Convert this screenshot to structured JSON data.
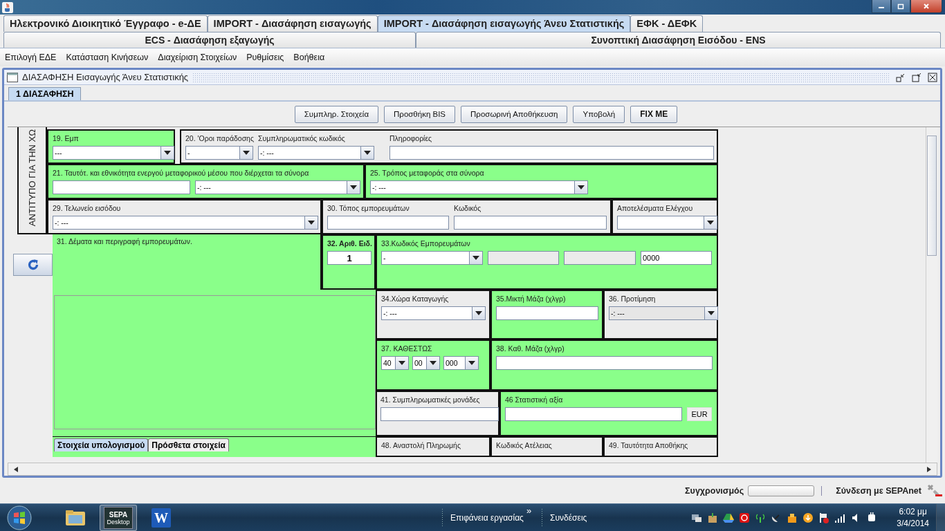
{
  "main_tabs": [
    [
      {
        "label": "Ηλεκτρονικό Διοικητικό Έγγραφο - e-ΔΕ",
        "selected": false
      },
      {
        "label": "IMPORT - Διασάφηση εισαγωγής",
        "selected": false
      },
      {
        "label": "IMPORT - Διασάφηση εισαγωγής Άνευ Στατιστικής",
        "selected": true
      },
      {
        "label": "ΕΦΚ - ΔΕΦΚ",
        "selected": false
      }
    ],
    [
      {
        "label": "ECS - Διασάφηση εξαγωγής",
        "selected": false
      },
      {
        "label": "Συνοπτική Διασάφηση Εισόδου - ENS",
        "selected": false
      }
    ]
  ],
  "menu": [
    "Επιλογή ΕΔΕ",
    "Κατάσταση Κινήσεων",
    "Διαχείριση Στοιχείων",
    "Ρυθμίσεις",
    "Βοήθεια"
  ],
  "frame": {
    "title": "ΔΙΑΣΑΦΗΣΗ Εισαγωγής Άνευ Στατιστικής",
    "tabs": [
      {
        "label": "1 ΔΙΑΣΑΦΗΣΗ",
        "selected": true
      }
    ],
    "buttons": [
      {
        "label": "Συμπληρ. Στοιχεία",
        "kind": "normal"
      },
      {
        "label": "Προσθήκη BIS",
        "kind": "normal"
      },
      {
        "label": "Προσωρινή Αποθήκευση",
        "kind": "normal"
      },
      {
        "label": "Υποβολή",
        "kind": "normal"
      },
      {
        "label": "FIX ME",
        "kind": "strong"
      }
    ]
  },
  "form": {
    "side_label": "ΑΝΤΙΤΥΠΟ ΓΙΑ ΤΗΝ ΧΩ",
    "boxes": [
      {
        "label": "19. Εμπ",
        "highlighted": true,
        "controls": [
          {
            "kind": "combo",
            "value": "---",
            "disabled": false
          }
        ]
      },
      {
        "highlighted": false,
        "controls": [
          {
            "kind": "combo",
            "label": "20. 'Οροι παράδοσης",
            "value": "-",
            "disabled": false
          },
          {
            "kind": "combo",
            "label": "Συμπληρωματικός κωδικός",
            "value": "-: ---",
            "disabled": false
          },
          {
            "kind": "input",
            "label": "Πληροφορίες",
            "disabled": false
          }
        ]
      },
      {
        "label": "21. Ταυτότ. και εθνικότητα ενεργού μεταφορικού μέσου που διέρχεται τα σύνορα",
        "highlighted": true,
        "controls": [
          {
            "kind": "input",
            "disabled": false
          },
          {
            "kind": "combo",
            "value": "-: ---",
            "disabled": false
          }
        ]
      },
      {
        "label": "25. Τρόπος μεταφοράς στα σύνορα",
        "highlighted": true,
        "controls": [
          {
            "kind": "combo",
            "value": "-: ---",
            "disabled": false
          }
        ]
      },
      {
        "label": "29. Τελωνείο εισόδου",
        "highlighted": false,
        "controls": [
          {
            "kind": "combo",
            "value": "-: ---",
            "disabled": false
          }
        ]
      },
      {
        "highlighted": false,
        "controls": [
          {
            "kind": "input",
            "label": "30. Τόπος εμπορευμάτων",
            "disabled": false
          },
          {
            "kind": "input",
            "label": "Κωδικός",
            "disabled": false
          }
        ]
      },
      {
        "label": "Αποτελέσματα Ελέγχου",
        "highlighted": false,
        "controls": [
          {
            "kind": "combo",
            "disabled": false
          }
        ]
      },
      {
        "label": "31. Δέματα και περιγραφή εμπορευμάτων.",
        "highlighted": true
      },
      {
        "label": "32. Αριθ. Ειδ.",
        "label_bold": true,
        "highlighted": true,
        "controls": [
          {
            "kind": "number",
            "value": "1",
            "disabled": false
          }
        ]
      },
      {
        "label": "33.Κωδικός Εμπορευμάτων",
        "highlighted": true,
        "controls": [
          {
            "kind": "combo",
            "value": "-",
            "disabled": false
          },
          {
            "kind": "input",
            "disabled": true
          },
          {
            "kind": "input",
            "disabled": true
          },
          {
            "kind": "input",
            "value": "0000",
            "disabled": false
          }
        ]
      },
      {
        "label": "34.Χώρα Καταγωγής",
        "highlighted": false,
        "controls": [
          {
            "kind": "combo",
            "value": "-: ---",
            "disabled": false
          }
        ]
      },
      {
        "label": "35.Μικτή Μάζα (χλγρ)",
        "highlighted": true,
        "controls": [
          {
            "kind": "input",
            "disabled": false
          }
        ]
      },
      {
        "label": "36. Προτίμηση",
        "highlighted": false,
        "controls": [
          {
            "kind": "combo",
            "value": "-: ---",
            "disabled": true
          }
        ]
      },
      {
        "label": "37. ΚΑΘΕΣΤΩΣ",
        "highlighted": true,
        "controls": [
          {
            "kind": "combo",
            "value": "40",
            "disabled": false
          },
          {
            "kind": "combo",
            "value": "00",
            "disabled": false
          },
          {
            "kind": "combo",
            "value": "000",
            "disabled": false
          }
        ]
      },
      {
        "label": "38. Καθ. Μάζα (χλγρ)",
        "highlighted": true,
        "controls": [
          {
            "kind": "input",
            "disabled": false
          }
        ]
      },
      {
        "label": "41. Συμπληρωματικές μονάδες",
        "highlighted": false,
        "controls": [
          {
            "kind": "input",
            "disabled": false
          }
        ]
      },
      {
        "label": "46 Στατιστική αξία",
        "highlighted": true,
        "controls": [
          {
            "kind": "input",
            "disabled": false
          },
          {
            "kind": "unit",
            "value": "EUR",
            "disabled": false
          }
        ]
      },
      {
        "label": "48. Αναστολή Πληρωμής",
        "highlighted": false
      },
      {
        "label": "Κωδικός Ατέλειας",
        "highlighted": false
      },
      {
        "label": "49. Ταυτότητα Αποθήκης",
        "highlighted": false
      }
    ],
    "lower_tabs": [
      {
        "label": "Στοιχεία υπολογισμού",
        "selected": true
      },
      {
        "label": "Πρόσθετα στοιχεία",
        "selected": false
      }
    ]
  },
  "status_bar": {
    "sync_label": "Συγχρονισμός",
    "sync": {
      "level": 0
    },
    "connection": "Σύνδεση με SEPAnet"
  },
  "taskbar": {
    "apps": [
      {
        "kind": "folder"
      },
      {
        "kind": "sepa",
        "label": "SEPA",
        "sublabel": "Desktop"
      },
      {
        "kind": "word",
        "label": "W"
      }
    ],
    "toolbars": [
      "Επιφάνεια εργασίας",
      "Συνδέσεις"
    ],
    "chevron": "»",
    "time": "6:02 μμ",
    "date": "3/4/2014"
  }
}
